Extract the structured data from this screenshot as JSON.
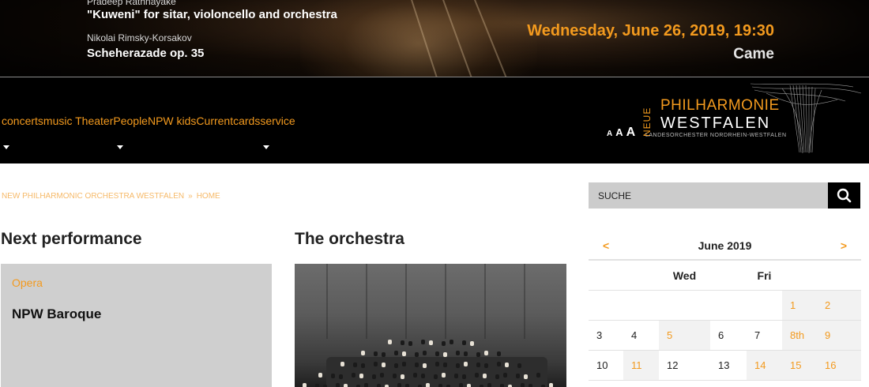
{
  "hero": {
    "composer_1": "Pradeep Rathnayake",
    "work_1": "\"Kuweni\" for sitar, violoncello and orchestra",
    "composer_2": "Nikolai Rimsky-Korsakov",
    "work_2": "Scheherazade op. 35",
    "date": "Wednesday, June 26, 2019, 19:30",
    "venue": "Came"
  },
  "nav": {
    "items": [
      "concerts",
      "music Theater",
      "People",
      "NPW kids",
      "Current",
      "cards",
      "service"
    ]
  },
  "font_size_controls": [
    "A",
    "A",
    "A"
  ],
  "logo": {
    "neue": "NEUE",
    "philharmonie": "PHILHARMONIE",
    "westfalen": "WESTFALEN",
    "subtitle": "LANDESORCHESTER NORDRHEIN-WESTFALEN"
  },
  "breadcrumb": {
    "items": [
      "NEW PHILHARMONIC ORCHESTRA WESTFALEN",
      "HOME"
    ],
    "separator": "»"
  },
  "next_performance": {
    "heading": "Next performance",
    "category": "Opera",
    "title": "NPW Baroque"
  },
  "orchestra": {
    "heading": "The orchestra"
  },
  "search": {
    "placeholder": "SUCHE"
  },
  "calendar": {
    "prev": "<",
    "next": ">",
    "month": "June 2019",
    "weekday_headers": [
      "",
      "",
      "Wed",
      "",
      "Fri",
      "",
      ""
    ],
    "rows": [
      [
        "",
        "",
        "",
        "",
        "",
        "1",
        "2"
      ],
      [
        "3",
        "4",
        "5",
        "6",
        "7",
        "8th",
        "9"
      ],
      [
        "10",
        "11",
        "12",
        "13",
        "14",
        "15",
        "16"
      ]
    ],
    "event_days": [
      "1",
      "2",
      "5",
      "8th",
      "9",
      "11",
      "14",
      "15",
      "16"
    ]
  },
  "colors": {
    "accent": "#f39a1e",
    "nav_background": "#000000",
    "card_background": "#cfcfcf",
    "search_background": "#cccccc"
  }
}
